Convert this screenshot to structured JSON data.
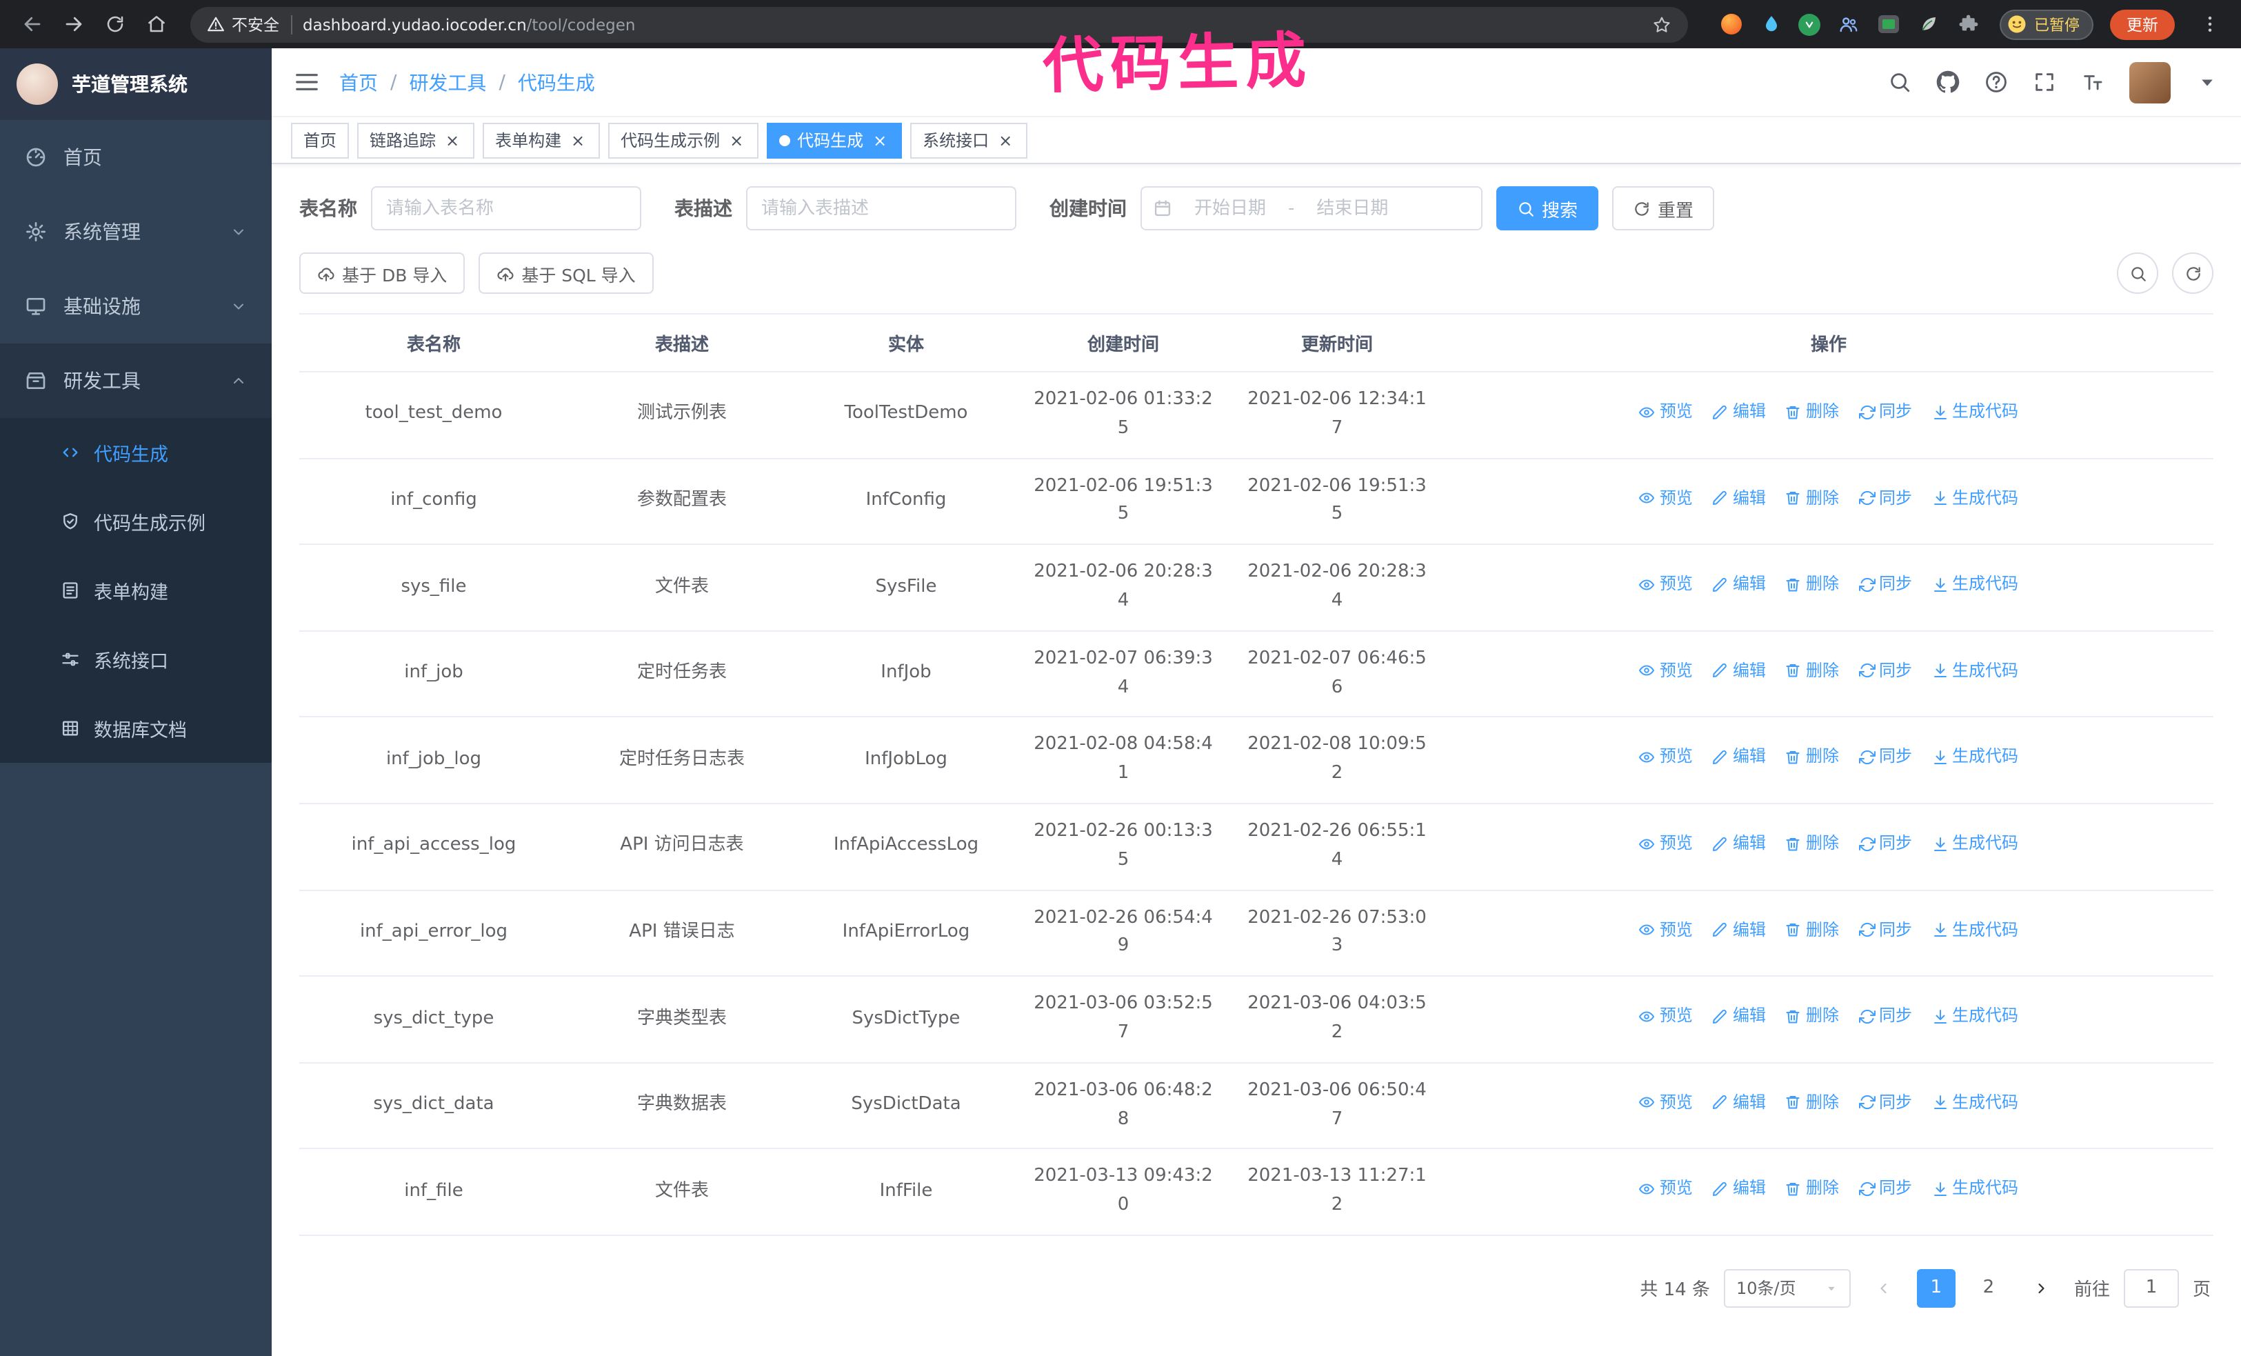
{
  "annotation": {
    "text": "代码生成",
    "color": "#fb2e8c"
  },
  "colors": {
    "primary": "#409eff",
    "sidebar_bg": "#304156",
    "annotation_pink": "#fb2e8c"
  },
  "browser": {
    "security_label": "不安全",
    "url_host": "dashboard.yudao.iocoder.cn",
    "url_path": "/tool/codegen",
    "profile_badge": "已暂停",
    "update_button": "更新"
  },
  "sidebar": {
    "logo_title": "芋道管理系统",
    "items": [
      {
        "label": "首页",
        "icon": "dashboard-icon"
      },
      {
        "label": "系统管理",
        "icon": "gear-icon",
        "expanded": false
      },
      {
        "label": "基础设施",
        "icon": "infra-icon",
        "expanded": false
      },
      {
        "label": "研发工具",
        "icon": "tools-icon",
        "expanded": true,
        "children": [
          {
            "label": "代码生成",
            "icon": "code-icon",
            "active": true
          },
          {
            "label": "代码生成示例",
            "icon": "shield-check-icon"
          },
          {
            "label": "表单构建",
            "icon": "form-icon"
          },
          {
            "label": "系统接口",
            "icon": "sliders-icon"
          },
          {
            "label": "数据库文档",
            "icon": "grid-icon"
          }
        ]
      }
    ]
  },
  "header": {
    "breadcrumb": [
      "首页",
      "研发工具",
      "代码生成"
    ],
    "separator": "/"
  },
  "tabs": [
    {
      "label": "首页",
      "closable": false,
      "active": false
    },
    {
      "label": "链路追踪",
      "closable": true,
      "active": false
    },
    {
      "label": "表单构建",
      "closable": true,
      "active": false
    },
    {
      "label": "代码生成示例",
      "closable": true,
      "active": false
    },
    {
      "label": "代码生成",
      "closable": true,
      "active": true
    },
    {
      "label": "系统接口",
      "closable": true,
      "active": false
    }
  ],
  "filters": {
    "table_name_label": "表名称",
    "table_name_placeholder": "请输入表名称",
    "table_desc_label": "表描述",
    "table_desc_placeholder": "请输入表描述",
    "create_time_label": "创建时间",
    "date_start_placeholder": "开始日期",
    "date_separator": "-",
    "date_end_placeholder": "结束日期",
    "search_label": "搜索",
    "reset_label": "重置"
  },
  "toolbar": {
    "import_db_label": "基于 DB 导入",
    "import_sql_label": "基于 SQL 导入"
  },
  "table": {
    "columns": [
      "表名称",
      "表描述",
      "实体",
      "创建时间",
      "更新时间",
      "操作"
    ],
    "actions": [
      "预览",
      "编辑",
      "删除",
      "同步",
      "生成代码"
    ],
    "rows": [
      {
        "name": "tool_test_demo",
        "desc": "测试示例表",
        "entity": "ToolTestDemo",
        "create_time": "2021-02-06 01:33:25",
        "update_time": "2021-02-06 12:34:17"
      },
      {
        "name": "inf_config",
        "desc": "参数配置表",
        "entity": "InfConfig",
        "create_time": "2021-02-06 19:51:35",
        "update_time": "2021-02-06 19:51:35"
      },
      {
        "name": "sys_file",
        "desc": "文件表",
        "entity": "SysFile",
        "create_time": "2021-02-06 20:28:34",
        "update_time": "2021-02-06 20:28:34"
      },
      {
        "name": "inf_job",
        "desc": "定时任务表",
        "entity": "InfJob",
        "create_time": "2021-02-07 06:39:34",
        "update_time": "2021-02-07 06:46:56"
      },
      {
        "name": "inf_job_log",
        "desc": "定时任务日志表",
        "entity": "InfJobLog",
        "create_time": "2021-02-08 04:58:41",
        "update_time": "2021-02-08 10:09:52"
      },
      {
        "name": "inf_api_access_log",
        "desc": "API 访问日志表",
        "entity": "InfApiAccessLog",
        "create_time": "2021-02-26 00:13:35",
        "update_time": "2021-02-26 06:55:14"
      },
      {
        "name": "inf_api_error_log",
        "desc": "API 错误日志",
        "entity": "InfApiErrorLog",
        "create_time": "2021-02-26 06:54:49",
        "update_time": "2021-02-26 07:53:03"
      },
      {
        "name": "sys_dict_type",
        "desc": "字典类型表",
        "entity": "SysDictType",
        "create_time": "2021-03-06 03:52:57",
        "update_time": "2021-03-06 04:03:52"
      },
      {
        "name": "sys_dict_data",
        "desc": "字典数据表",
        "entity": "SysDictData",
        "create_time": "2021-03-06 06:48:28",
        "update_time": "2021-03-06 06:50:47"
      },
      {
        "name": "inf_file",
        "desc": "文件表",
        "entity": "InfFile",
        "create_time": "2021-03-13 09:43:20",
        "update_time": "2021-03-13 11:27:12"
      }
    ]
  },
  "pagination": {
    "total_text": "共 14 条",
    "page_size": "10条/页",
    "pages": [
      "1",
      "2"
    ],
    "current_page": "1",
    "goto_prefix": "前往",
    "goto_value": "1",
    "goto_suffix": "页"
  },
  "icons": {
    "search": "magnifier",
    "github": "octocat",
    "question": "question-circle",
    "fullscreen": "expand-corners",
    "font_size": "letter-T",
    "calendar": "calendar",
    "import": "cloud-upload",
    "preview": "eye",
    "edit": "pencil",
    "delete": "trash",
    "sync": "circular-arrows",
    "generate_code": "download-arrow"
  }
}
